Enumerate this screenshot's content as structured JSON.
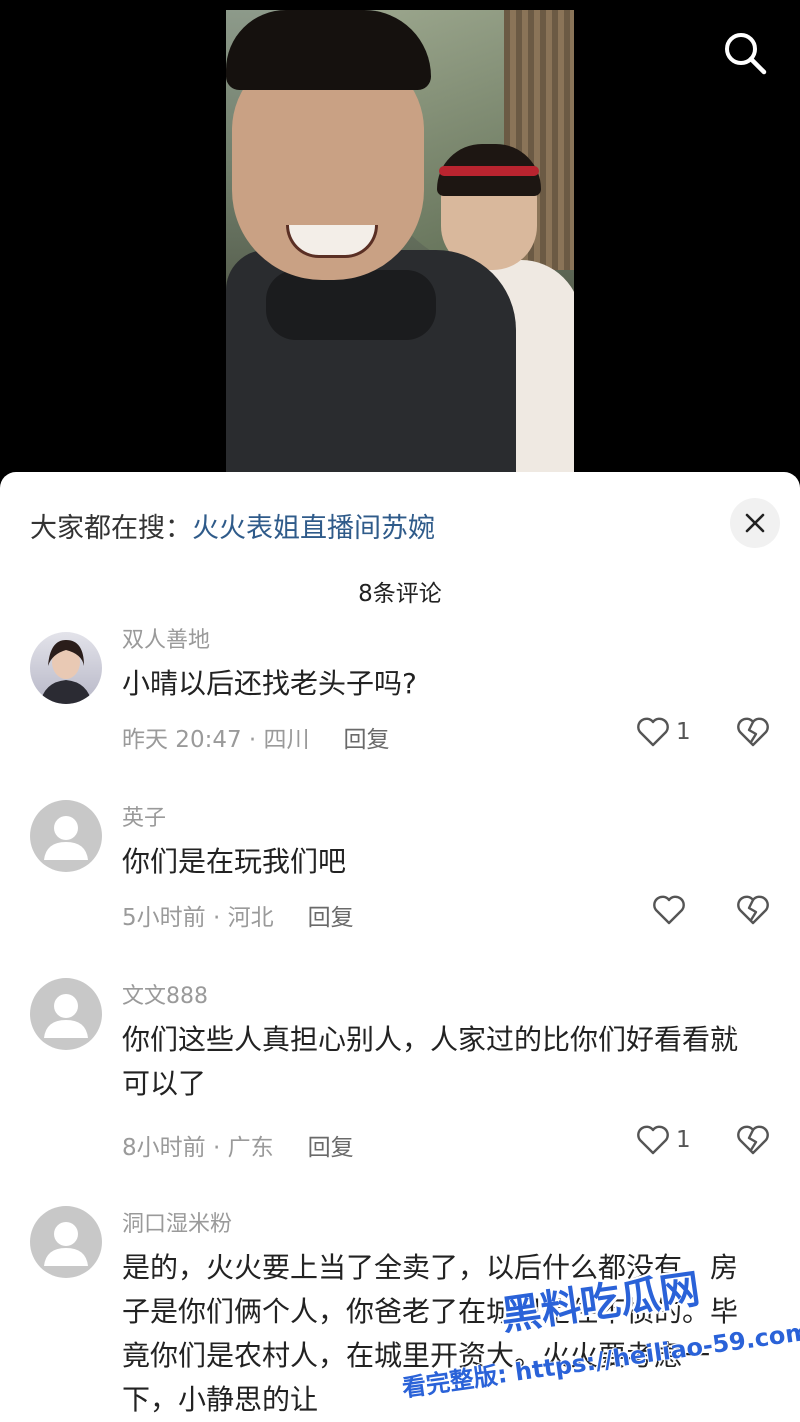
{
  "sheet": {
    "search_prefix": "大家都在搜：",
    "search_term": "火火表姐直播间苏婉",
    "comment_count_label": "8条评论"
  },
  "comments": [
    {
      "username": "双人善地",
      "text": "小晴以后还找老头子吗?",
      "meta": "昨天 20:47 · 四川",
      "reply": "回复",
      "likes": "1",
      "avatar": "photo"
    },
    {
      "username": "英子",
      "text": "你们是在玩我们吧",
      "meta": "5小时前 · 河北",
      "reply": "回复",
      "likes": "",
      "avatar": "default"
    },
    {
      "username": "文文888",
      "text": "你们这些人真担心别人，人家过的比你们好看看就可以了",
      "meta": "8小时前 · 广东",
      "reply": "回复",
      "likes": "1",
      "avatar": "default"
    },
    {
      "username": "洞口湿米粉",
      "text": "是的，火火要上当了全卖了，以后什么都没有，房子是你们俩个人，你爸老了在城里是住不惯的。毕竟你们是农村人，在城里开资大。火火要考虑一下，小静思的让",
      "meta": "",
      "reply": "",
      "likes": "",
      "avatar": "default"
    }
  ],
  "watermark": {
    "main": "黑料吃瓜网",
    "url": "看完整版: https://heiliao-59.com"
  },
  "colors": {
    "link": "#2f5b8a",
    "meta": "#9a9a9a",
    "watermark": "#2a62d8"
  }
}
